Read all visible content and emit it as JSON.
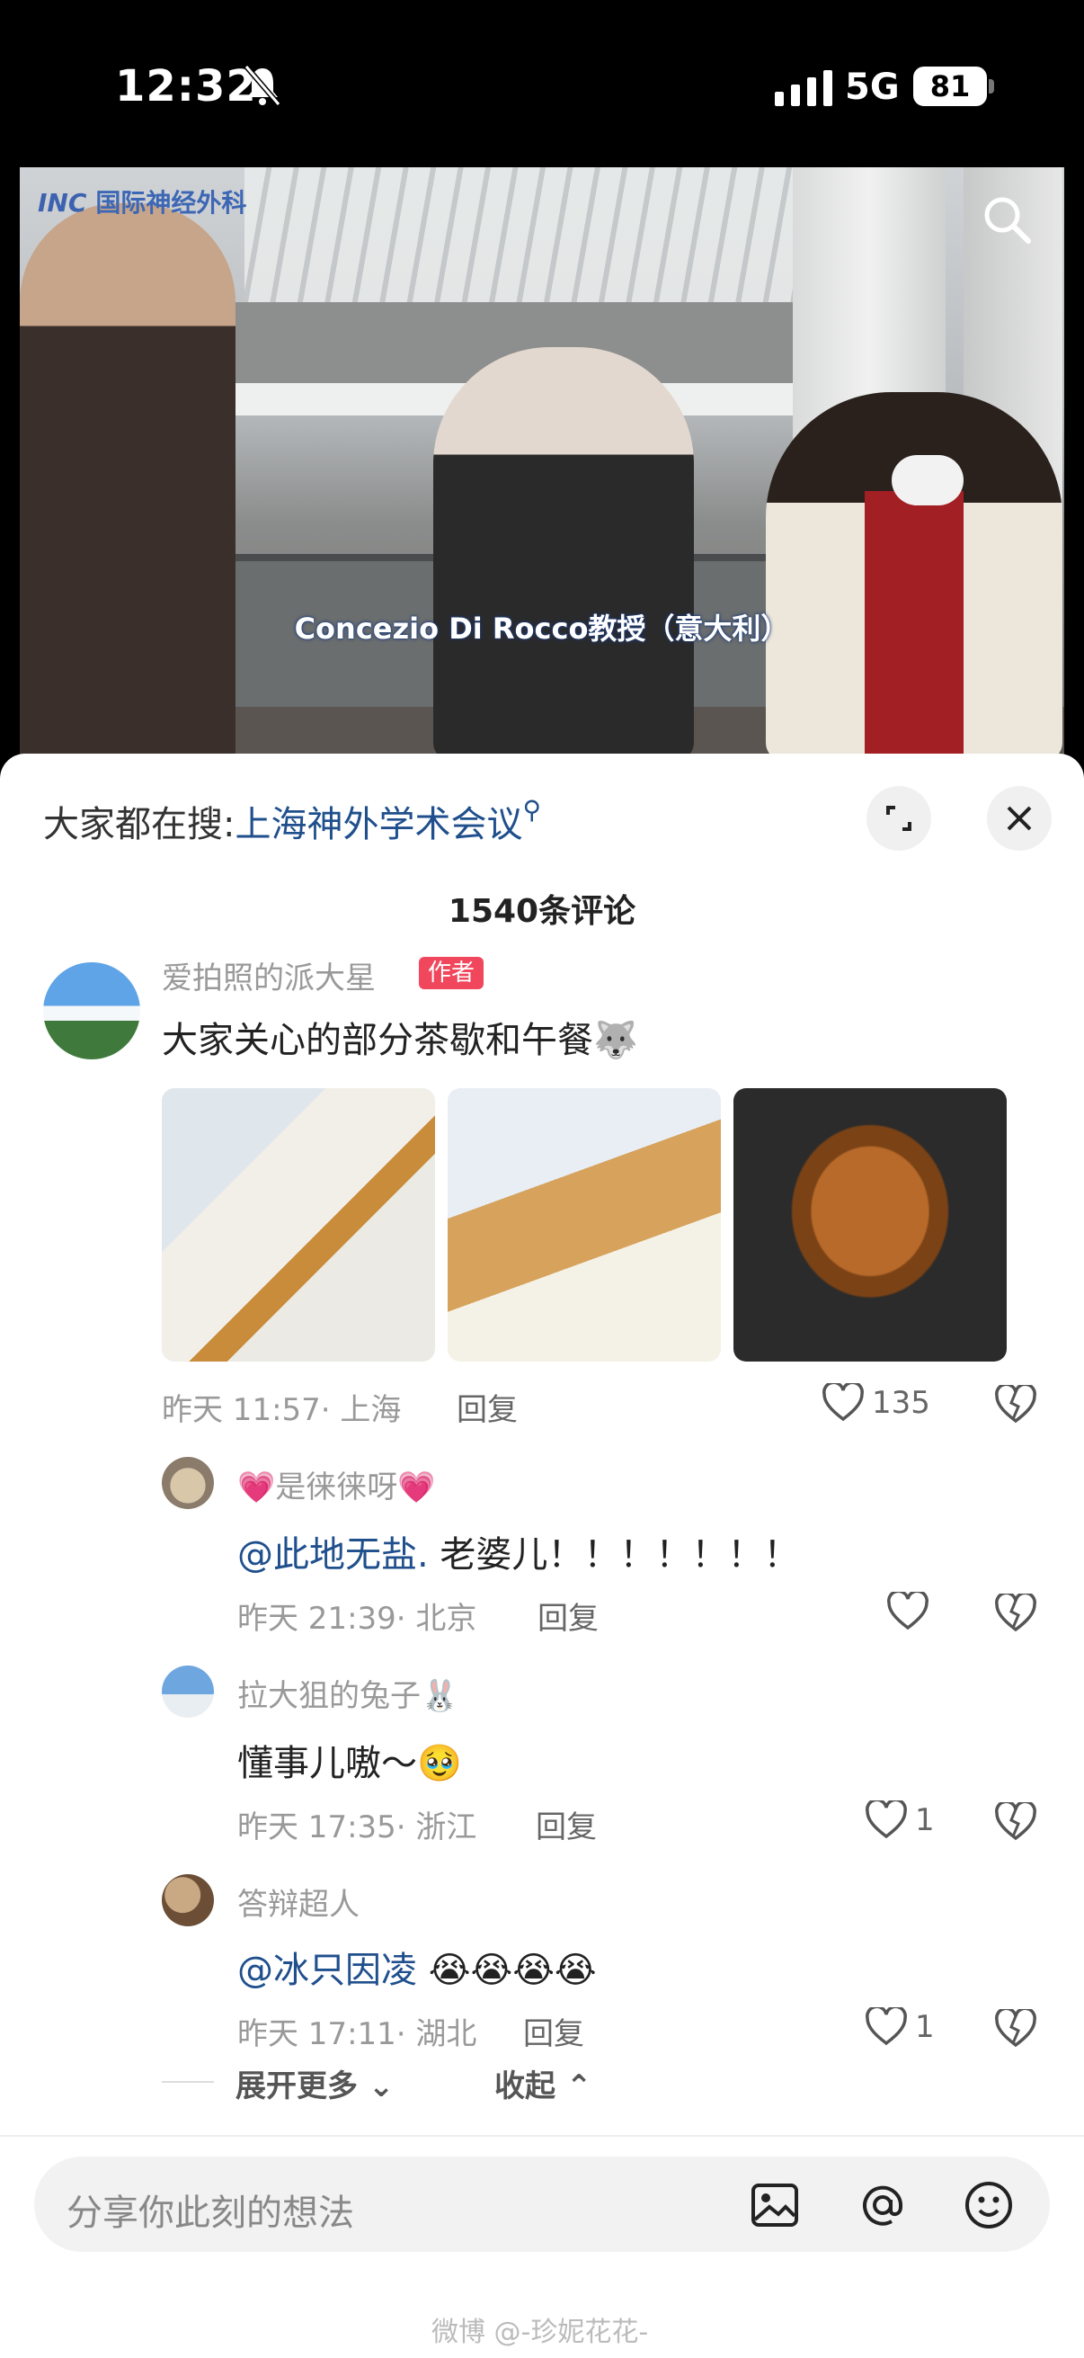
{
  "status_bar": {
    "time": "12:32",
    "network": "5G",
    "battery": "81"
  },
  "video": {
    "logo_text": "国际神经外科",
    "caption": "Concezio Di Rocco教授（意大利）"
  },
  "sheet": {
    "search_prefix": "大家都在搜:",
    "search_keyword": "上海神外学术会议",
    "comment_count": "1540条评论"
  },
  "comments": [
    {
      "author": "爱拍照的派大星",
      "badge": "作者",
      "text": "大家关心的部分茶歇和午餐",
      "text_emoji": "🐺",
      "time_location": "昨天 11:57· 上海",
      "reply_label": "回复",
      "likes": "135"
    },
    {
      "author": "是徕徕呀",
      "name_emoji": "💗",
      "mention": "@此地无盐.",
      "text": " 老婆儿！！！！！！！",
      "time_location": "昨天 21:39· 北京",
      "reply_label": "回复",
      "likes": ""
    },
    {
      "author": "拉大狙的兔子",
      "name_emoji": "🐰",
      "text": "懂事儿嗷～",
      "text_emoji": "🥹",
      "time_location": "昨天 17:35· 浙江",
      "reply_label": "回复",
      "likes": "1"
    },
    {
      "author": "答辩超人",
      "mention": "@冰只因凌",
      "text_emoji": "😭😭😭😭",
      "time_location": "昨天 17:11· 湖北",
      "reply_label": "回复",
      "likes": "1"
    }
  ],
  "thread_controls": {
    "expand": "展开更多",
    "collapse": "收起"
  },
  "input": {
    "placeholder": "分享你此刻的想法"
  },
  "watermark": "微博 @-珍妮花花-",
  "colors": {
    "accent_blue": "#1f4f8c",
    "author_badge": "#f0475d"
  },
  "icons": [
    "bell-slash-icon",
    "signal-icon",
    "search-icon",
    "expand-icon",
    "close-icon",
    "heart-icon",
    "broken-heart-icon",
    "image-icon",
    "at-icon",
    "emoji-icon",
    "chevron-down-icon",
    "chevron-up-icon"
  ]
}
